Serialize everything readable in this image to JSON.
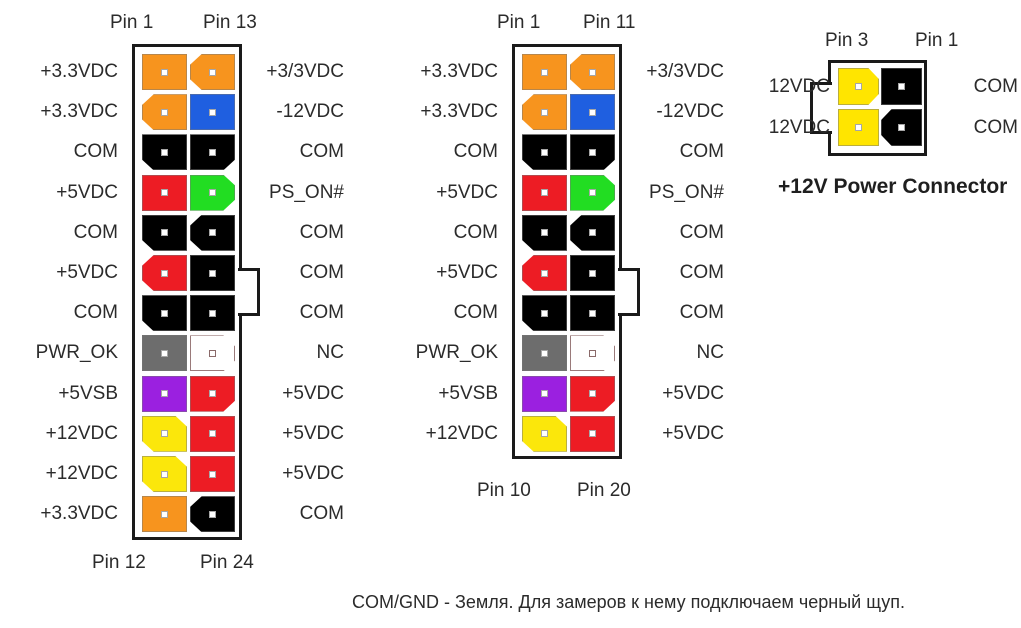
{
  "diagram": {
    "caption": "COM/GND - Земля. Для замеров к нему подключаем черный щуп.",
    "colors": {
      "orange": "#F7941E",
      "blue": "#1F5FE0",
      "black": "#000000",
      "red": "#ED1C24",
      "green": "#22DD22",
      "gray": "#6D6D6D",
      "white": "#FFFFFF",
      "purple": "#9B20E0",
      "yellow": "#FBE70B",
      "yellow_bright": "#FFE500",
      "outline": "#1A1A1A"
    }
  },
  "connector_24pin": {
    "header_left": "Pin 1",
    "header_right": "Pin 13",
    "footer_left": "Pin 12",
    "footer_right": "Pin 24",
    "rows": [
      {
        "left_label": "+3.3VDC",
        "right_label": "+3/3VDC",
        "left_color": "orange",
        "right_color": "orange",
        "left_notch": "none",
        "right_notch": "left-both"
      },
      {
        "left_label": "+3.3VDC",
        "right_label": "-12VDC",
        "left_color": "orange",
        "right_color": "blue",
        "left_notch": "left-both",
        "right_notch": "none"
      },
      {
        "left_label": "COM",
        "right_label": "COM",
        "left_color": "black",
        "right_color": "black",
        "left_notch": "bottom-left",
        "right_notch": "bottom-right"
      },
      {
        "left_label": "+5VDC",
        "right_label": "PS_ON#",
        "left_color": "red",
        "right_color": "green",
        "left_notch": "none",
        "right_notch": "right-both"
      },
      {
        "left_label": "COM",
        "right_label": "COM",
        "left_color": "black",
        "right_color": "black",
        "left_notch": "bottom-left",
        "right_notch": "left-both"
      },
      {
        "left_label": "+5VDC",
        "right_label": "COM",
        "left_color": "red",
        "right_color": "black",
        "left_notch": "left-both",
        "right_notch": "none"
      },
      {
        "left_label": "COM",
        "right_label": "COM",
        "left_color": "black",
        "right_color": "black",
        "left_notch": "bottom-left",
        "right_notch": "none"
      },
      {
        "left_label": "PWR_OK",
        "right_label": "NC",
        "left_color": "gray",
        "right_color": "white",
        "left_notch": "none",
        "right_notch": "right-both"
      },
      {
        "left_label": "+5VSB",
        "right_label": "+5VDC",
        "left_color": "purple",
        "right_color": "red",
        "left_notch": "none",
        "right_notch": "bottom-right"
      },
      {
        "left_label": "+12VDC",
        "right_label": "+5VDC",
        "left_color": "yellow",
        "right_color": "red",
        "left_notch": "diag-tlbl",
        "right_notch": "none"
      },
      {
        "left_label": "+12VDC",
        "right_label": "+5VDC",
        "left_color": "yellow",
        "right_color": "red",
        "left_notch": "diag-tlbl",
        "right_notch": "none"
      },
      {
        "left_label": "+3.3VDC",
        "right_label": "COM",
        "left_color": "orange",
        "right_color": "black",
        "left_notch": "none",
        "right_notch": "left-both"
      }
    ]
  },
  "connector_20pin": {
    "header_left": "Pin 1",
    "header_right": "Pin 11",
    "footer_left": "Pin 10",
    "footer_right": "Pin 20",
    "rows": [
      {
        "left_label": "+3.3VDC",
        "right_label": "+3/3VDC",
        "left_color": "orange",
        "right_color": "orange",
        "left_notch": "none",
        "right_notch": "left-both"
      },
      {
        "left_label": "+3.3VDC",
        "right_label": "-12VDC",
        "left_color": "orange",
        "right_color": "blue",
        "left_notch": "left-both",
        "right_notch": "none"
      },
      {
        "left_label": "COM",
        "right_label": "COM",
        "left_color": "black",
        "right_color": "black",
        "left_notch": "bottom-left",
        "right_notch": "bottom-right"
      },
      {
        "left_label": "+5VDC",
        "right_label": "PS_ON#",
        "left_color": "red",
        "right_color": "green",
        "left_notch": "none",
        "right_notch": "right-both"
      },
      {
        "left_label": "COM",
        "right_label": "COM",
        "left_color": "black",
        "right_color": "black",
        "left_notch": "bottom-left",
        "right_notch": "left-both"
      },
      {
        "left_label": "+5VDC",
        "right_label": "COM",
        "left_color": "red",
        "right_color": "black",
        "left_notch": "left-both",
        "right_notch": "none"
      },
      {
        "left_label": "COM",
        "right_label": "COM",
        "left_color": "black",
        "right_color": "black",
        "left_notch": "bottom-left",
        "right_notch": "none"
      },
      {
        "left_label": "PWR_OK",
        "right_label": "NC",
        "left_color": "gray",
        "right_color": "white",
        "left_notch": "none",
        "right_notch": "right-both"
      },
      {
        "left_label": "+5VSB",
        "right_label": "+5VDC",
        "left_color": "purple",
        "right_color": "red",
        "left_notch": "none",
        "right_notch": "bottom-right"
      },
      {
        "left_label": "+12VDC",
        "right_label": "+5VDC",
        "left_color": "yellow",
        "right_color": "red",
        "left_notch": "diag-tlbl",
        "right_notch": "none"
      }
    ]
  },
  "connector_12v": {
    "title": "+12V Power Connector",
    "header_left": "Pin 3",
    "header_right": "Pin 1",
    "rows": [
      {
        "left_label": "12VDC",
        "right_label": "COM",
        "left_color": "yellow_bright",
        "right_color": "black",
        "left_notch": "right-both",
        "right_notch": "none"
      },
      {
        "left_label": "12VDC",
        "right_label": "COM",
        "left_color": "yellow_bright",
        "right_color": "black",
        "left_notch": "none",
        "right_notch": "left-both"
      }
    ]
  }
}
